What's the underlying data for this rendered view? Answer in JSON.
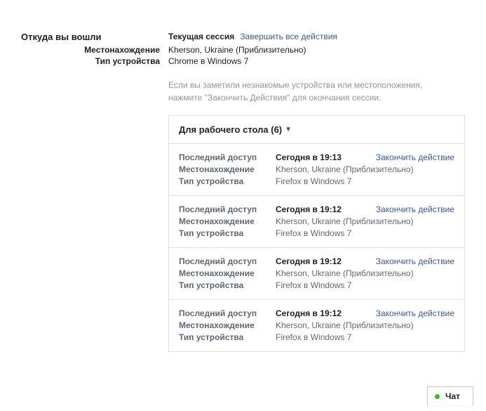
{
  "section_title": "Откуда вы вошли",
  "current_session": {
    "label": "Текущая сессия",
    "end_all": "Завершить все действия",
    "location_label": "Местонахождение",
    "location_value": "Kherson, Ukraine (Приблизительно)",
    "device_label": "Тип устройства",
    "device_value": "Chrome в Windows 7"
  },
  "notice": "Если вы заметили незнакомые устройства или местоположения, нажмите \"Закончить Действия\" для окончания сессии.",
  "panel": {
    "title": "Для рабочего стола (6)"
  },
  "labels": {
    "last_access": "Последний доступ",
    "location": "Местонахождение",
    "device": "Тип устройства",
    "end_action": "Закончить действие"
  },
  "sessions": [
    {
      "last_access": "Сегодня в 19:13",
      "location": "Kherson, Ukraine (Приблизительно)",
      "device": "Firefox в Windows 7"
    },
    {
      "last_access": "Сегодня в 19:12",
      "location": "Kherson, Ukraine (Приблизительно)",
      "device": "Firefox в Windows 7"
    },
    {
      "last_access": "Сегодня в 19:12",
      "location": "Kherson, Ukraine (Приблизительно)",
      "device": "Firefox в Windows 7"
    },
    {
      "last_access": "Сегодня в 19:12",
      "location": "Kherson, Ukraine (Приблизительно)",
      "device": "Firefox в Windows 7"
    }
  ],
  "chat": {
    "label": "Чат"
  }
}
